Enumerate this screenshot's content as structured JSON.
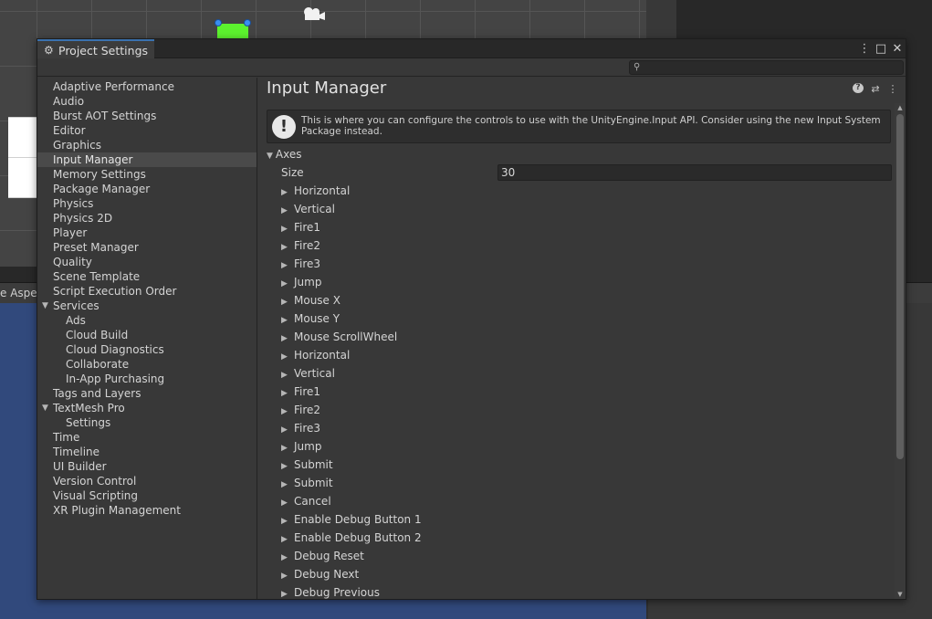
{
  "background": {
    "game_view_label": "e Aspec"
  },
  "window": {
    "tab_title": "Project Settings",
    "controls": {
      "menu": "⋮",
      "maximize": "□",
      "close": "✕"
    },
    "search": {
      "placeholder": "",
      "value": ""
    }
  },
  "sidebar": {
    "items": [
      {
        "label": "Adaptive Performance",
        "indent": 0
      },
      {
        "label": "Audio",
        "indent": 0
      },
      {
        "label": "Burst AOT Settings",
        "indent": 0
      },
      {
        "label": "Editor",
        "indent": 0
      },
      {
        "label": "Graphics",
        "indent": 0
      },
      {
        "label": "Input Manager",
        "indent": 0,
        "selected": true
      },
      {
        "label": "Memory Settings",
        "indent": 0
      },
      {
        "label": "Package Manager",
        "indent": 0
      },
      {
        "label": "Physics",
        "indent": 0
      },
      {
        "label": "Physics 2D",
        "indent": 0
      },
      {
        "label": "Player",
        "indent": 0
      },
      {
        "label": "Preset Manager",
        "indent": 0
      },
      {
        "label": "Quality",
        "indent": 0
      },
      {
        "label": "Scene Template",
        "indent": 0
      },
      {
        "label": "Script Execution Order",
        "indent": 0
      },
      {
        "label": "Services",
        "indent": 0,
        "expanded": true
      },
      {
        "label": "Ads",
        "indent": 1
      },
      {
        "label": "Cloud Build",
        "indent": 1
      },
      {
        "label": "Cloud Diagnostics",
        "indent": 1
      },
      {
        "label": "Collaborate",
        "indent": 1
      },
      {
        "label": "In-App Purchasing",
        "indent": 1
      },
      {
        "label": "Tags and Layers",
        "indent": 0
      },
      {
        "label": "TextMesh Pro",
        "indent": 0,
        "expanded": true
      },
      {
        "label": "Settings",
        "indent": 1
      },
      {
        "label": "Time",
        "indent": 0
      },
      {
        "label": "Timeline",
        "indent": 0
      },
      {
        "label": "UI Builder",
        "indent": 0
      },
      {
        "label": "Version Control",
        "indent": 0
      },
      {
        "label": "Visual Scripting",
        "indent": 0
      },
      {
        "label": "XR Plugin Management",
        "indent": 0
      }
    ]
  },
  "content": {
    "title": "Input Manager",
    "info_text": "This is where you can configure the controls to use with the UnityEngine.Input API. Consider using the new Input System Package instead.",
    "axes_label": "Axes",
    "size_label": "Size",
    "size_value": "30",
    "axes": [
      "Horizontal",
      "Vertical",
      "Fire1",
      "Fire2",
      "Fire3",
      "Jump",
      "Mouse X",
      "Mouse Y",
      "Mouse ScrollWheel",
      "Horizontal",
      "Vertical",
      "Fire1",
      "Fire2",
      "Fire3",
      "Jump",
      "Submit",
      "Submit",
      "Cancel",
      "Enable Debug Button 1",
      "Enable Debug Button 2",
      "Debug Reset",
      "Debug Next",
      "Debug Previous"
    ]
  },
  "colors": {
    "accent": "#3a72b0",
    "selected_row": "#4a4a4a",
    "game_view": "#31497c",
    "green_object": "#5cf22e"
  }
}
